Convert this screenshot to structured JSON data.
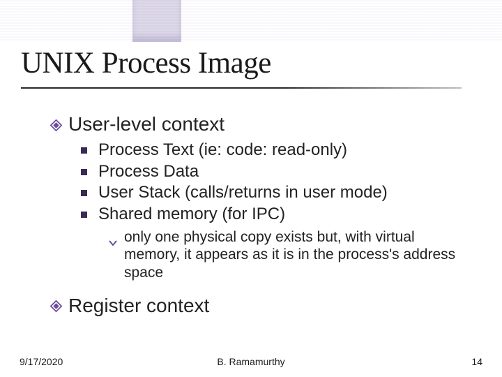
{
  "title": "UNIX Process Image",
  "sections": [
    {
      "label": "User-level context",
      "items": [
        "Process Text (ie: code: read-only)",
        "Process Data",
        "User Stack (calls/returns in user mode)",
        "Shared memory (for IPC)"
      ],
      "note": "only one physical copy exists but, with virtual memory, it appears as it is in the process's address space"
    },
    {
      "label": "Register context"
    }
  ],
  "footer": {
    "date": "9/17/2020",
    "author": "B. Ramamurthy",
    "page": "14"
  },
  "colors": {
    "accent": "#6a4c9c",
    "bullet": "#3a2b55"
  }
}
